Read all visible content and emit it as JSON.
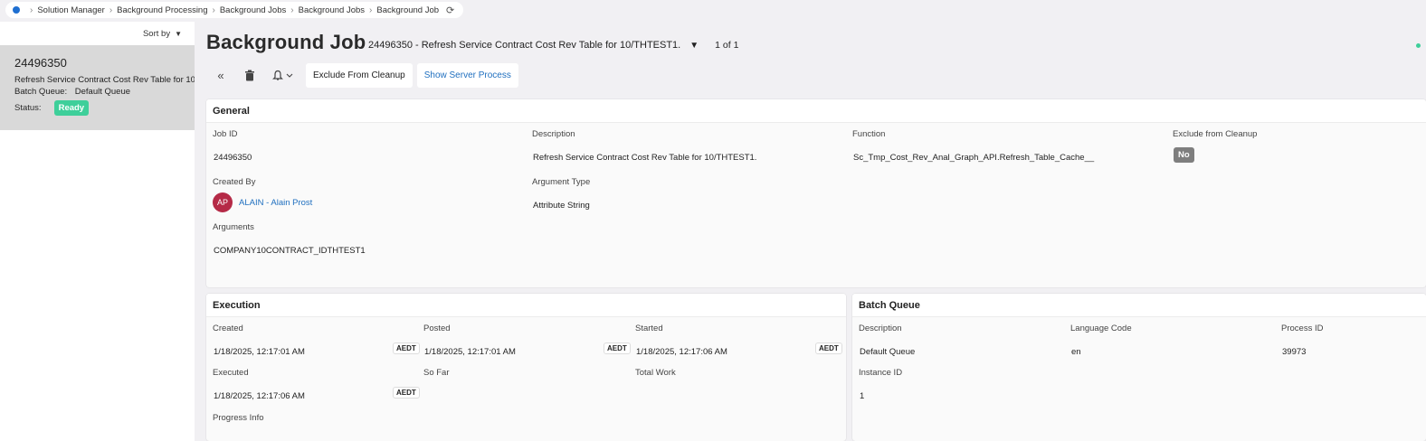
{
  "breadcrumb": [
    "Solution Manager",
    "Background Processing",
    "Background Jobs",
    "Background Jobs",
    "Background Job"
  ],
  "left_panel": {
    "sort_label": "Sort by",
    "card": {
      "id": "24496350",
      "description": "Refresh Service Contract Cost Rev Table for 10",
      "queue_label": "Batch Queue:",
      "queue_value": "Default Queue",
      "status_label": "Status:",
      "status_value": "Ready"
    }
  },
  "header": {
    "title": "Background Job",
    "subtitle": "24496350 - Refresh Service Contract Cost Rev Table for 10/THTEST1.",
    "pager": "1 of 1"
  },
  "toolbar": {
    "exclude_label": "Exclude From Cleanup",
    "server_label": "Show Server Process"
  },
  "general": {
    "title": "General",
    "job_id_label": "Job ID",
    "job_id": "24496350",
    "description_label": "Description",
    "description": "Refresh Service Contract Cost Rev Table for 10/THTEST1.",
    "function_label": "Function",
    "function": "Sc_Tmp_Cost_Rev_Anal_Graph_API.Refresh_Table_Cache__",
    "exclude_label": "Exclude from Cleanup",
    "exclude_value": "No",
    "created_by_label": "Created By",
    "created_by_initials": "AP",
    "created_by": "ALAIN - Alain Prost",
    "argument_type_label": "Argument Type",
    "argument_type": "Attribute String",
    "arguments_label": "Arguments",
    "arguments": "COMPANY10CONTRACT_IDTHTEST1"
  },
  "execution": {
    "title": "Execution",
    "created_label": "Created",
    "created": "1/18/2025, 12:17:01 AM",
    "posted_label": "Posted",
    "posted": "1/18/2025, 12:17:01 AM",
    "started_label": "Started",
    "started": "1/18/2025, 12:17:06 AM",
    "executed_label": "Executed",
    "executed": "1/18/2025, 12:17:06 AM",
    "so_far_label": "So Far",
    "total_work_label": "Total Work",
    "progress_label": "Progress Info",
    "timezone": "AEDT"
  },
  "batch_queue": {
    "title": "Batch Queue",
    "description_label": "Description",
    "description": "Default Queue",
    "language_label": "Language Code",
    "language": "en",
    "process_label": "Process ID",
    "process": "39973",
    "instance_label": "Instance ID",
    "instance": "1"
  },
  "colors": {
    "accent_blue": "#1f6fbf",
    "ready_green": "#3ecf9a",
    "avatar_red": "#b52a47",
    "badge_grey": "#7e7e7e"
  }
}
